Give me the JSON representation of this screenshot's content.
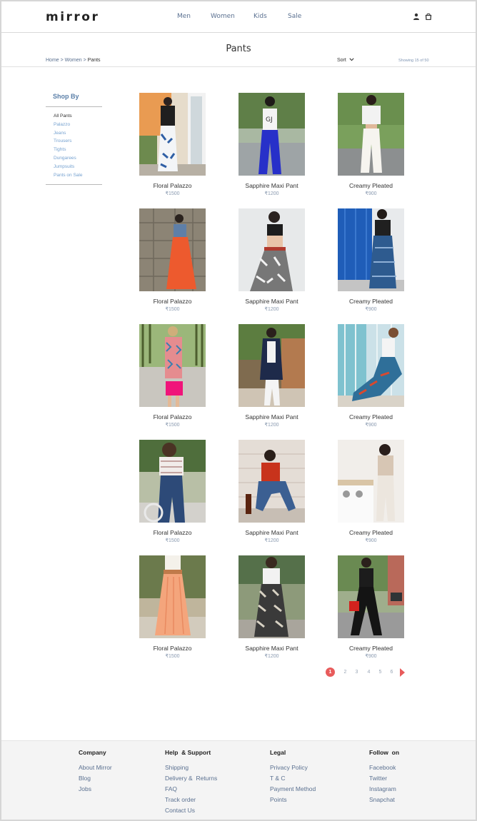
{
  "header": {
    "logo": "mirror",
    "nav": [
      "Men",
      "Women",
      "Kids",
      "Sale"
    ],
    "icons": [
      "user-icon",
      "shopping-bag-icon"
    ]
  },
  "page": {
    "title": "Pants",
    "breadcrumb": {
      "home": "Home",
      "sep1": " > ",
      "section": "Women",
      "sep2": " > ",
      "current": "Pants"
    },
    "sort_label": "Sort",
    "showing": "Showing 15 of 50"
  },
  "sidebar": {
    "title": "Shop By",
    "items": [
      "All Pants",
      "Palazzo",
      "Jeans",
      "Trousers",
      "Tights",
      "Dungarees",
      "Jumpsuits",
      "Pants on Sale"
    ]
  },
  "products": [
    {
      "name": "Floral Palazzo",
      "price": "₹1500"
    },
    {
      "name": "Sapphire Maxi Pant",
      "price": "₹1200"
    },
    {
      "name": "Creamy Pleated",
      "price": "₹900"
    },
    {
      "name": "Floral Palazzo",
      "price": "₹1500"
    },
    {
      "name": "Sapphire Maxi Pant",
      "price": "₹1200"
    },
    {
      "name": "Creamy Pleated",
      "price": "₹900"
    },
    {
      "name": "Floral Palazzo",
      "price": "₹1500"
    },
    {
      "name": "Sapphire Maxi Pant",
      "price": "₹1200"
    },
    {
      "name": "Creamy Pleated",
      "price": "₹900"
    },
    {
      "name": "Floral Palazzo",
      "price": "₹1500"
    },
    {
      "name": "Sapphire Maxi Pant",
      "price": "₹1200"
    },
    {
      "name": "Creamy Pleated",
      "price": "₹900"
    },
    {
      "name": "Floral Palazzo",
      "price": "₹1500"
    },
    {
      "name": "Sapphire Maxi Pant",
      "price": "₹1200"
    },
    {
      "name": "Creamy Pleated",
      "price": "₹900"
    }
  ],
  "pagination": {
    "pages": [
      "1",
      "2",
      "3",
      "4",
      "5",
      "6"
    ],
    "current": "1"
  },
  "footer": {
    "columns": [
      {
        "heading": "Company",
        "links": [
          "About Mirror",
          "Blog",
          "Jobs"
        ]
      },
      {
        "heading": "Help  & Support",
        "links": [
          "Shipping",
          "Delivery &  Returns",
          "FAQ",
          "Track order",
          "Contact Us"
        ]
      },
      {
        "heading": "Legal",
        "links": [
          "Privacy Policy",
          "T & C",
          "Payment Method",
          "Points"
        ]
      },
      {
        "heading": "Follow  on",
        "links": [
          "Facebook",
          "Twitter",
          "Instagram",
          "Snapchat"
        ]
      }
    ]
  },
  "colors": {
    "accent": "#e85b5b",
    "link": "#5a7090",
    "sidebar_link": "#76a2d0",
    "footer_bg": "#f4f4f4"
  }
}
